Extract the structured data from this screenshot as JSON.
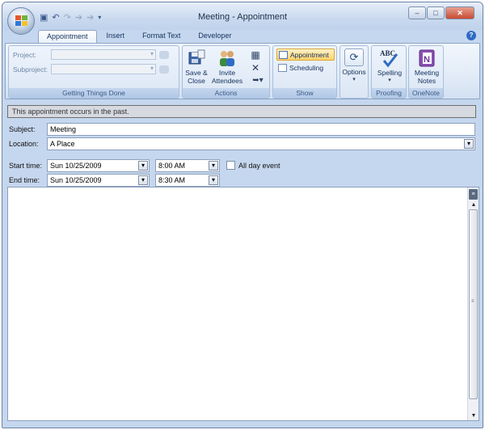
{
  "window": {
    "title": "Meeting - Appointment",
    "buttons": {
      "minimize": "–",
      "maximize": "□",
      "close": "✕"
    }
  },
  "qat": {
    "save_icon": "save-icon",
    "undo_icon": "undo-icon",
    "redo_icon": "redo-icon",
    "prev_icon": "up-arrow-icon",
    "next_icon": "down-arrow-icon",
    "customize_icon": "customize-qat-icon"
  },
  "ribbon": {
    "tabs": [
      {
        "label": "Appointment",
        "active": true
      },
      {
        "label": "Insert",
        "active": false
      },
      {
        "label": "Format Text",
        "active": false
      },
      {
        "label": "Developer",
        "active": false
      }
    ],
    "groups": {
      "getting_things_done": {
        "label": "Getting Things Done",
        "project_label": "Project:",
        "subproject_label": "Subproject:"
      },
      "actions": {
        "label": "Actions",
        "save_close": "Save & Close",
        "invite": "Invite Attendees"
      },
      "show": {
        "label": "Show",
        "appointment": "Appointment",
        "scheduling": "Scheduling"
      },
      "options": {
        "label": "Options"
      },
      "proofing": {
        "label": "Proofing",
        "spelling": "Spelling"
      },
      "onenote": {
        "label": "OneNote",
        "meeting_notes": "Meeting Notes"
      }
    }
  },
  "form": {
    "info_bar": "This appointment occurs in the past.",
    "subject_label": "Subject:",
    "subject_value": "Meeting",
    "location_label": "Location:",
    "location_value": "A Place",
    "start_label": "Start time:",
    "start_date": "Sun 10/25/2009",
    "start_time": "8:00 AM",
    "end_label": "End time:",
    "end_date": "Sun 10/25/2009",
    "end_time": "8:30 AM",
    "all_day_label": "All day event",
    "all_day_checked": false
  },
  "colors": {
    "frame": "#c5d7ee",
    "highlight": "#ffd36b",
    "info_bar": "#d6d9df"
  }
}
